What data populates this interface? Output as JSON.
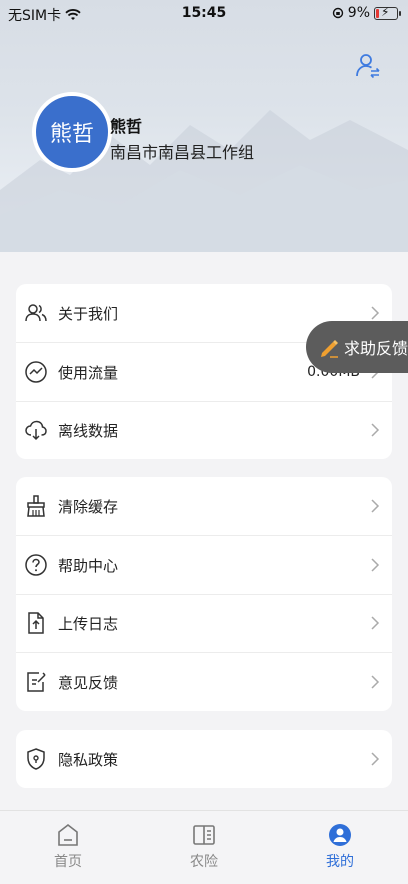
{
  "status_bar": {
    "carrier": "无SIM卡",
    "time": "15:45",
    "battery": "9%"
  },
  "profile": {
    "avatar_text": "熊哲",
    "name": "熊哲",
    "org": "南昌市南昌县工作组"
  },
  "menu_group1": [
    {
      "label": "关于我们",
      "icon": "users-icon"
    },
    {
      "label": "使用流量",
      "icon": "traffic-icon",
      "value": "0.00MB"
    },
    {
      "label": "离线数据",
      "icon": "cloud-download-icon"
    }
  ],
  "menu_group2": [
    {
      "label": "清除缓存",
      "icon": "broom-icon"
    },
    {
      "label": "帮助中心",
      "icon": "help-icon"
    },
    {
      "label": "上传日志",
      "icon": "upload-file-icon"
    },
    {
      "label": "意见反馈",
      "icon": "edit-note-icon"
    }
  ],
  "menu_group3": [
    {
      "label": "隐私政策",
      "icon": "shield-lock-icon"
    }
  ],
  "floating_feedback": {
    "label": "求助反馈"
  },
  "tabbar": [
    {
      "label": "首页",
      "icon": "home-icon"
    },
    {
      "label": "农险",
      "icon": "book-icon"
    },
    {
      "label": "我的",
      "icon": "user-icon",
      "active": true
    }
  ],
  "colors": {
    "accent": "#2f6fd8",
    "avatar_bg": "#3a6fcc",
    "float_bg": "#5c5c5c"
  }
}
